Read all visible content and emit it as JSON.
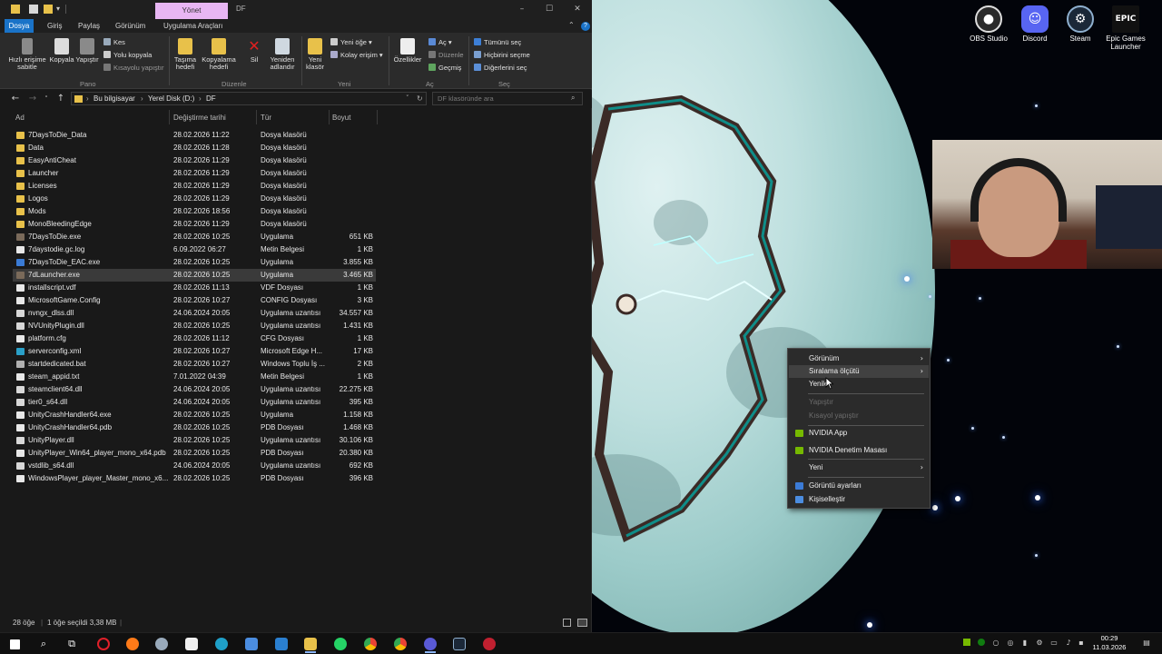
{
  "explorer": {
    "contextual_tab": "Yönet",
    "window_title": "DF",
    "ribbon_tabs": [
      "Dosya",
      "Giriş",
      "Paylaş",
      "Görünüm",
      "Uygulama Araçları"
    ],
    "ribbon": {
      "pin_quick_access": "Hızlı erişime sabitle",
      "copy": "Kopyala",
      "paste": "Yapıştır",
      "cut": "Kes",
      "copy_path": "Yolu kopyala",
      "paste_shortcut": "Kısayolu yapıştır",
      "move_to": "Taşıma hedefi",
      "copy_to": "Kopyalama hedefi",
      "delete": "Sil",
      "rename": "Yeniden adlandır",
      "new_folder": "Yeni klasör",
      "new_item": "Yeni öğe",
      "easy_access": "Kolay erişim",
      "properties": "Özellikler",
      "open": "Aç",
      "edit": "Düzenle",
      "history": "Geçmiş",
      "select_all": "Tümünü seç",
      "select_none": "Hiçbirini seçme",
      "invert_selection": "Diğerlerini seç",
      "group_clipboard": "Pano",
      "group_organize": "Düzenle",
      "group_new": "Yeni",
      "group_open": "Aç",
      "group_select": "Seç"
    },
    "address": [
      "Bu bilgisayar",
      "Yerel Disk (D:)",
      "DF"
    ],
    "search_placeholder": "DF klasöründe ara",
    "columns": [
      "Ad",
      "Değiştirme tarihi",
      "Tür",
      "Boyut"
    ],
    "files": [
      {
        "name": "7DaysToDie_Data",
        "date": "28.02.2026 11:22",
        "type": "Dosya klasörü",
        "size": "",
        "kind": "folder"
      },
      {
        "name": "Data",
        "date": "28.02.2026 11:28",
        "type": "Dosya klasörü",
        "size": "",
        "kind": "folder"
      },
      {
        "name": "EasyAntiCheat",
        "date": "28.02.2026 11:29",
        "type": "Dosya klasörü",
        "size": "",
        "kind": "folder"
      },
      {
        "name": "Launcher",
        "date": "28.02.2026 11:29",
        "type": "Dosya klasörü",
        "size": "",
        "kind": "folder"
      },
      {
        "name": "Licenses",
        "date": "28.02.2026 11:29",
        "type": "Dosya klasörü",
        "size": "",
        "kind": "folder"
      },
      {
        "name": "Logos",
        "date": "28.02.2026 11:29",
        "type": "Dosya klasörü",
        "size": "",
        "kind": "folder"
      },
      {
        "name": "Mods",
        "date": "28.02.2026 18:56",
        "type": "Dosya klasörü",
        "size": "",
        "kind": "folder"
      },
      {
        "name": "MonoBleedingEdge",
        "date": "28.02.2026 11:29",
        "type": "Dosya klasörü",
        "size": "",
        "kind": "folder"
      },
      {
        "name": "7DaysToDie.exe",
        "date": "28.02.2026 10:25",
        "type": "Uygulama",
        "size": "651 KB",
        "kind": "exe"
      },
      {
        "name": "7daystodie.gc.log",
        "date": "6.09.2022 06:27",
        "type": "Metin Belgesi",
        "size": "1 KB",
        "kind": "doc"
      },
      {
        "name": "7DaysToDie_EAC.exe",
        "date": "28.02.2026 10:25",
        "type": "Uygulama",
        "size": "3.855 KB",
        "kind": "eac"
      },
      {
        "name": "7dLauncher.exe",
        "date": "28.02.2026 10:25",
        "type": "Uygulama",
        "size": "3.465 KB",
        "kind": "exe"
      },
      {
        "name": "installscript.vdf",
        "date": "28.02.2026 11:13",
        "type": "VDF Dosyası",
        "size": "1 KB",
        "kind": "doc"
      },
      {
        "name": "MicrosoftGame.Config",
        "date": "28.02.2026 10:27",
        "type": "CONFIG Dosyası",
        "size": "3 KB",
        "kind": "doc"
      },
      {
        "name": "nvngx_dlss.dll",
        "date": "24.06.2024 20:05",
        "type": "Uygulama uzantısı",
        "size": "34.557 KB",
        "kind": "dll"
      },
      {
        "name": "NVUnityPlugin.dll",
        "date": "28.02.2026 10:25",
        "type": "Uygulama uzantısı",
        "size": "1.431 KB",
        "kind": "dll"
      },
      {
        "name": "platform.cfg",
        "date": "28.02.2026 11:12",
        "type": "CFG Dosyası",
        "size": "1 KB",
        "kind": "doc"
      },
      {
        "name": "serverconfig.xml",
        "date": "28.02.2026 10:27",
        "type": "Microsoft Edge H...",
        "size": "17 KB",
        "kind": "edge"
      },
      {
        "name": "startdedicated.bat",
        "date": "28.02.2026 10:27",
        "type": "Windows Toplu İş ...",
        "size": "2 KB",
        "kind": "bat"
      },
      {
        "name": "steam_appid.txt",
        "date": "7.01.2022 04:39",
        "type": "Metin Belgesi",
        "size": "1 KB",
        "kind": "doc"
      },
      {
        "name": "steamclient64.dll",
        "date": "24.06.2024 20:05",
        "type": "Uygulama uzantısı",
        "size": "22.275 KB",
        "kind": "dll"
      },
      {
        "name": "tier0_s64.dll",
        "date": "24.06.2024 20:05",
        "type": "Uygulama uzantısı",
        "size": "395 KB",
        "kind": "dll"
      },
      {
        "name": "UnityCrashHandler64.exe",
        "date": "28.02.2026 10:25",
        "type": "Uygulama",
        "size": "1.158 KB",
        "kind": "unity"
      },
      {
        "name": "UnityCrashHandler64.pdb",
        "date": "28.02.2026 10:25",
        "type": "PDB Dosyası",
        "size": "1.468 KB",
        "kind": "doc"
      },
      {
        "name": "UnityPlayer.dll",
        "date": "28.02.2026 10:25",
        "type": "Uygulama uzantısı",
        "size": "30.106 KB",
        "kind": "dll"
      },
      {
        "name": "UnityPlayer_Win64_player_mono_x64.pdb",
        "date": "28.02.2026 10:25",
        "type": "PDB Dosyası",
        "size": "20.380 KB",
        "kind": "doc"
      },
      {
        "name": "vstdlib_s64.dll",
        "date": "24.06.2024 20:05",
        "type": "Uygulama uzantısı",
        "size": "692 KB",
        "kind": "dll"
      },
      {
        "name": "WindowsPlayer_player_Master_mono_x6...",
        "date": "28.02.2026 10:25",
        "type": "PDB Dosyası",
        "size": "396 KB",
        "kind": "doc"
      }
    ],
    "selected_index": 11,
    "status": {
      "count": "28 öğe",
      "selection": "1 öğe seçildi 3,38 MB"
    }
  },
  "desktop_icons": [
    {
      "label": "OBS Studio",
      "icon": "obs-icon",
      "color": "#2a2a2a"
    },
    {
      "label": "Discord",
      "icon": "discord-icon",
      "color": "#5865f2"
    },
    {
      "label": "Steam",
      "icon": "steam-icon",
      "color": "#1b2838"
    },
    {
      "label": "Epic Games Launcher",
      "icon": "epic-icon",
      "color": "#111111"
    }
  ],
  "context_menu": {
    "items": [
      {
        "label": "Görünüm",
        "submenu": true,
        "disabled": false
      },
      {
        "label": "Sıralama ölçütü",
        "submenu": true,
        "disabled": false
      },
      {
        "label": "Yenile",
        "submenu": false,
        "disabled": false
      },
      {
        "label": "Yapıştır",
        "submenu": false,
        "disabled": true
      },
      {
        "label": "Kısayol yapıştır",
        "submenu": false,
        "disabled": true
      },
      {
        "label": "NVIDIA App",
        "submenu": false,
        "disabled": false
      },
      {
        "label": "NVIDIA Denetim Masası",
        "submenu": false,
        "disabled": false
      },
      {
        "label": "Yeni",
        "submenu": true,
        "disabled": false
      },
      {
        "label": "Görüntü ayarları",
        "submenu": false,
        "disabled": false
      },
      {
        "label": "Kişiselleştir",
        "submenu": false,
        "disabled": false
      }
    ]
  },
  "taskbar": {
    "clock_time": "00:29",
    "clock_date": "11.03.2026"
  },
  "colors": {
    "accent": "#1a73c8",
    "folder": "#e8c14a",
    "contextual_tab": "#e8b6f3"
  }
}
